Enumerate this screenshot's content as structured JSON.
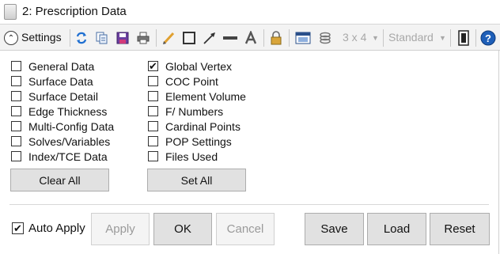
{
  "window": {
    "title": "2: Prescription Data"
  },
  "toolbar": {
    "settings_label": "Settings",
    "layout_value": "3 x 4",
    "style_value": "Standard"
  },
  "left_options": [
    {
      "label": "General Data",
      "checked": false
    },
    {
      "label": "Surface Data",
      "checked": false
    },
    {
      "label": "Surface Detail",
      "checked": false
    },
    {
      "label": "Edge Thickness",
      "checked": false
    },
    {
      "label": "Multi-Config Data",
      "checked": false
    },
    {
      "label": "Solves/Variables",
      "checked": false
    },
    {
      "label": "Index/TCE Data",
      "checked": false
    }
  ],
  "right_options": [
    {
      "label": "Global Vertex",
      "checked": true
    },
    {
      "label": "COC Point",
      "checked": false
    },
    {
      "label": "Element Volume",
      "checked": false
    },
    {
      "label": "F/ Numbers",
      "checked": false
    },
    {
      "label": "Cardinal Points",
      "checked": false
    },
    {
      "label": "POP Settings",
      "checked": false
    },
    {
      "label": "Files Used",
      "checked": false
    }
  ],
  "buttons": {
    "clear_all": "Clear All",
    "set_all": "Set All",
    "apply": "Apply",
    "ok": "OK",
    "cancel": "Cancel",
    "save": "Save",
    "load": "Load",
    "reset": "Reset"
  },
  "footer": {
    "auto_apply_label": "Auto Apply",
    "auto_apply_checked": true
  }
}
